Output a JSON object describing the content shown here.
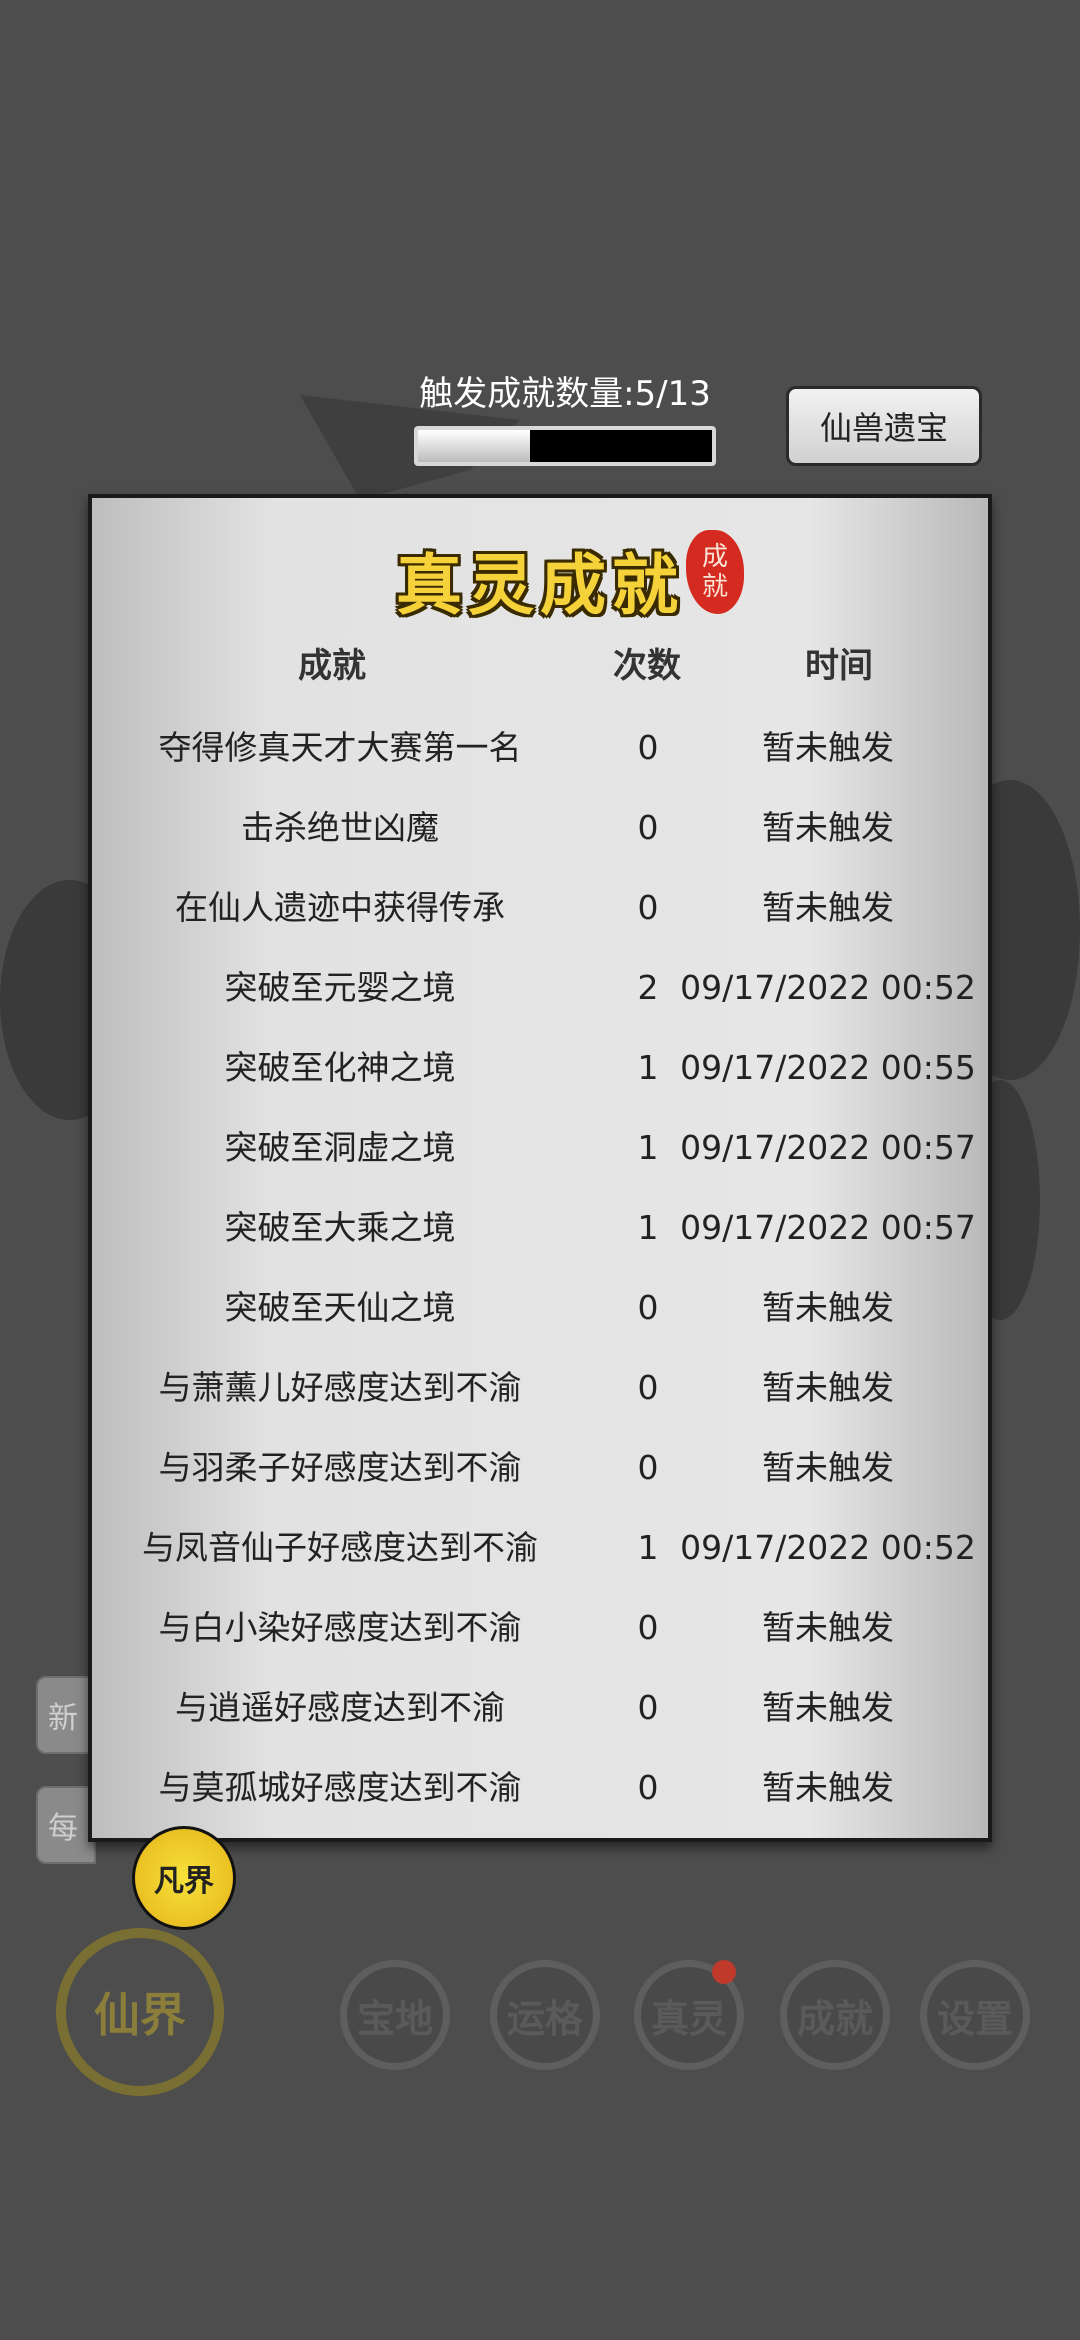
{
  "header": {
    "counter_label": "触发成就数量:5/13",
    "progress_fraction": 0.38,
    "treasure_button": "仙兽遗宝"
  },
  "panel": {
    "title": "真灵成就",
    "seal_text": [
      "成",
      "就"
    ],
    "columns": {
      "name": "成就",
      "count": "次数",
      "time": "时间"
    },
    "rows": [
      {
        "name": "夺得修真天才大赛第一名",
        "count": "0",
        "time": "暂未触发"
      },
      {
        "name": "击杀绝世凶魔",
        "count": "0",
        "time": "暂未触发"
      },
      {
        "name": "在仙人遗迹中获得传承",
        "count": "0",
        "time": "暂未触发"
      },
      {
        "name": "突破至元婴之境",
        "count": "2",
        "time": "09/17/2022 00:52"
      },
      {
        "name": "突破至化神之境",
        "count": "1",
        "time": "09/17/2022 00:55"
      },
      {
        "name": "突破至洞虚之境",
        "count": "1",
        "time": "09/17/2022 00:57"
      },
      {
        "name": "突破至大乘之境",
        "count": "1",
        "time": "09/17/2022 00:57"
      },
      {
        "name": "突破至天仙之境",
        "count": "0",
        "time": "暂未触发"
      },
      {
        "name": "与萧薰儿好感度达到不渝",
        "count": "0",
        "time": "暂未触发"
      },
      {
        "name": "与羽柔子好感度达到不渝",
        "count": "0",
        "time": "暂未触发"
      },
      {
        "name": "与凤音仙子好感度达到不渝",
        "count": "1",
        "time": "09/17/2022 00:52"
      },
      {
        "name": "与白小染好感度达到不渝",
        "count": "0",
        "time": "暂未触发"
      },
      {
        "name": "与逍遥好感度达到不渝",
        "count": "0",
        "time": "暂未触发"
      },
      {
        "name": "与莫孤城好感度达到不渝",
        "count": "0",
        "time": "暂未触发"
      }
    ]
  },
  "side_buttons": [
    "新",
    "每"
  ],
  "gourd_label": "凡界",
  "realm_label": "仙界",
  "nav": [
    "宝地",
    "运格",
    "真灵",
    "成就",
    "设置"
  ]
}
